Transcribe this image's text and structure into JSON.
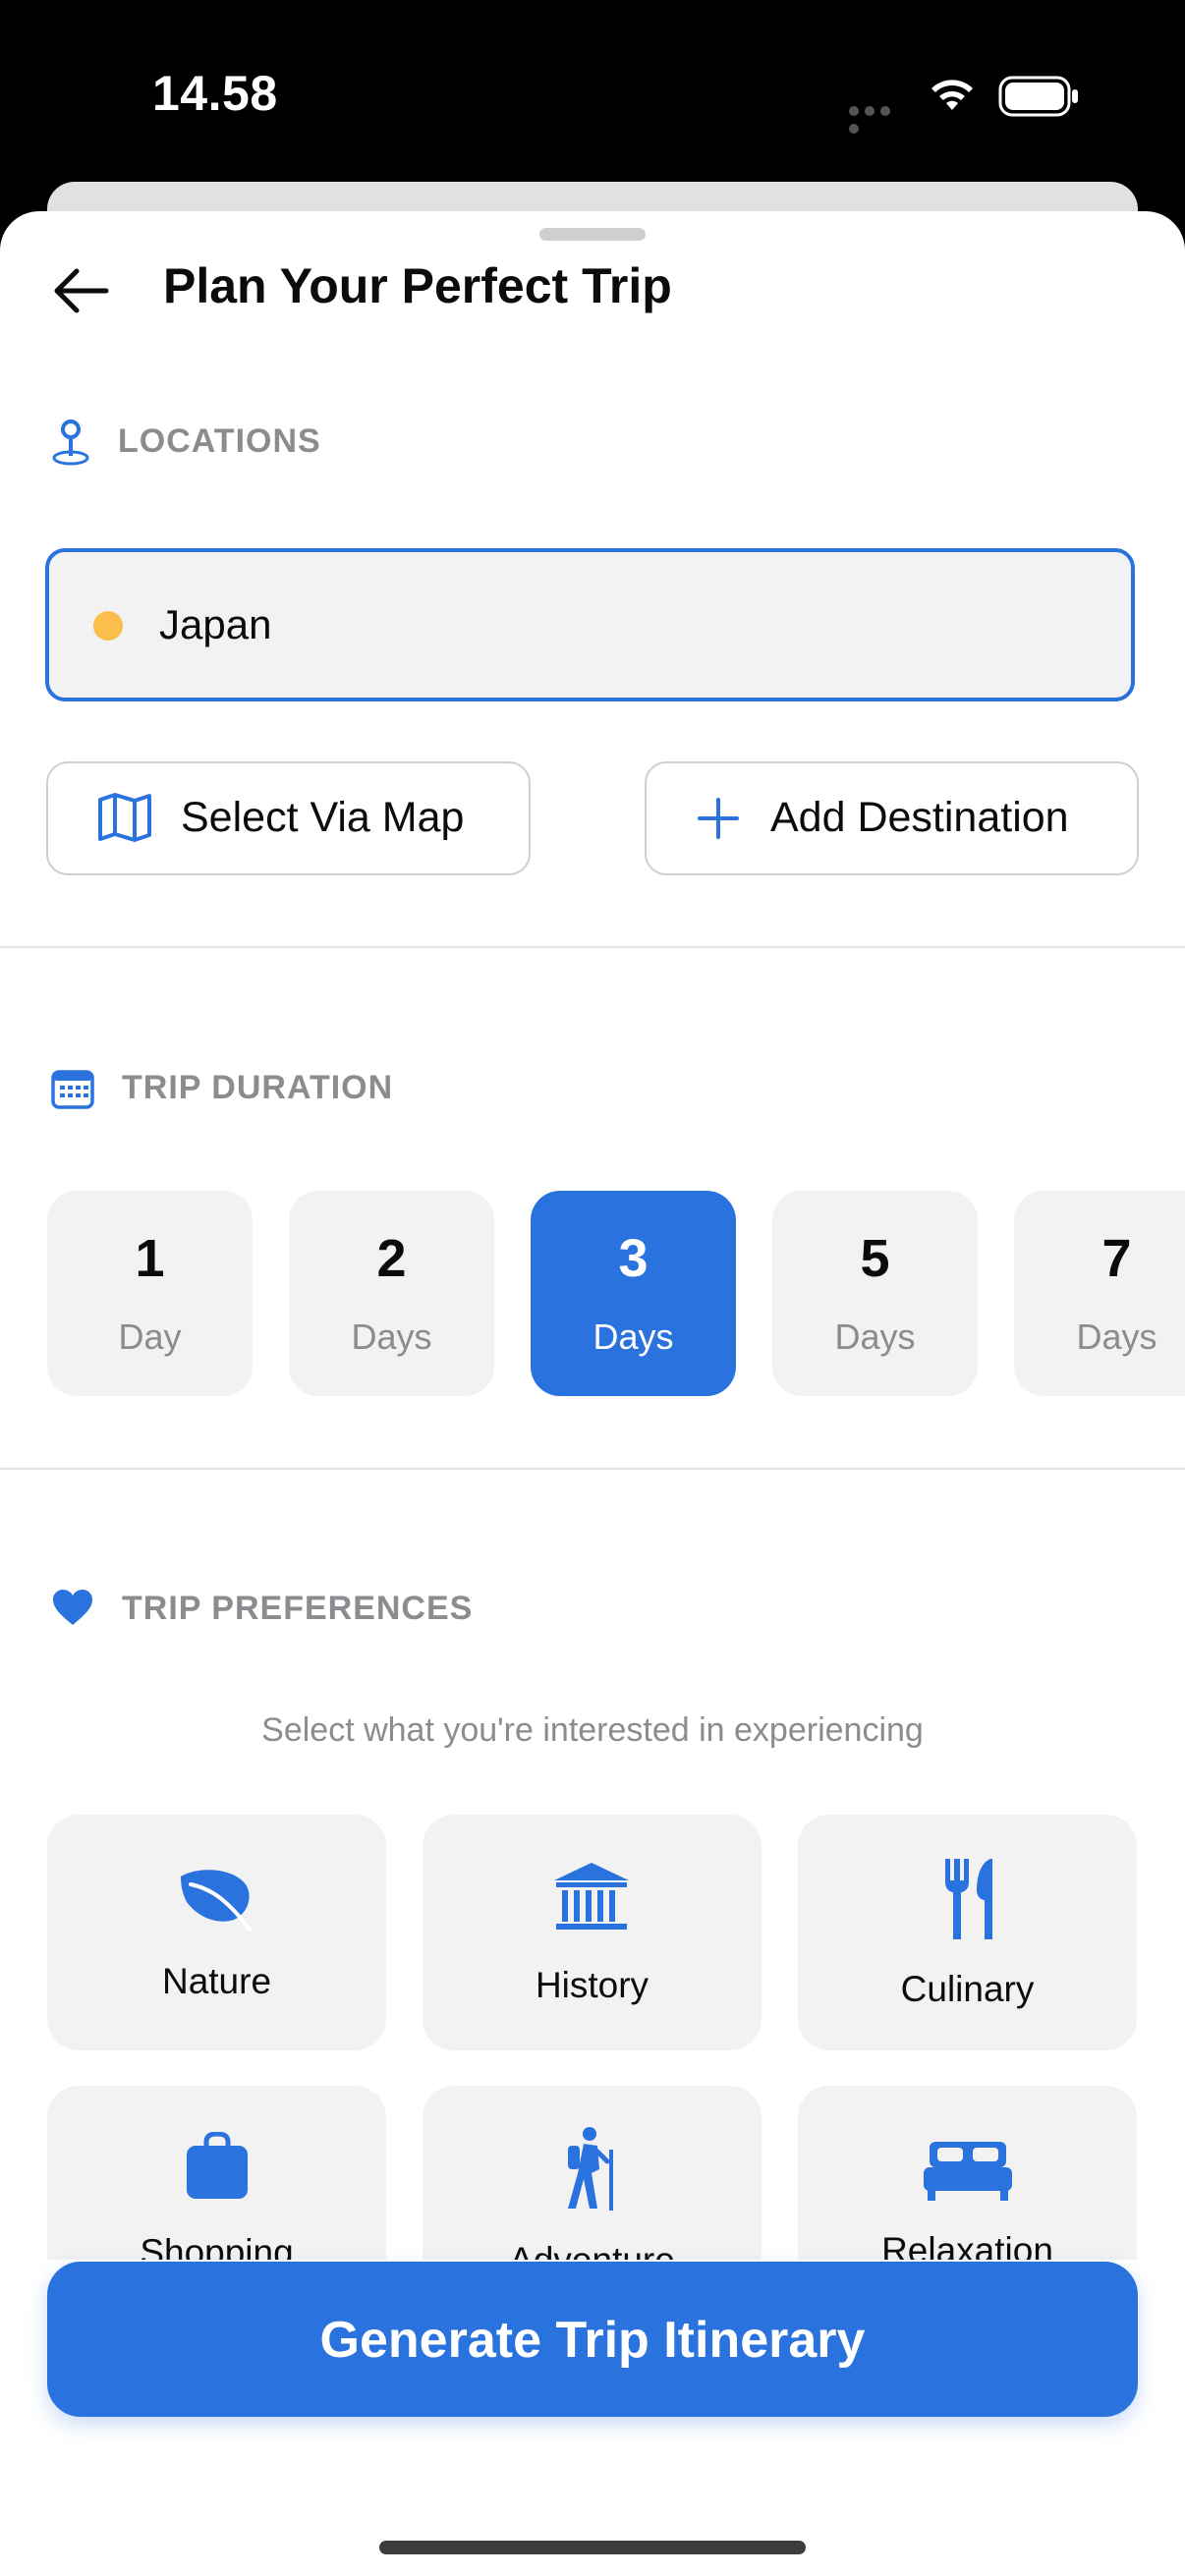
{
  "status_bar": {
    "time": "14.58"
  },
  "header": {
    "title": "Plan Your Perfect Trip"
  },
  "locations": {
    "label": "LOCATIONS",
    "destination_value": "Japan",
    "select_via_map": "Select Via Map",
    "add_destination": "Add Destination"
  },
  "duration": {
    "label": "TRIP DURATION",
    "options": [
      {
        "num": "1",
        "unit": "Day"
      },
      {
        "num": "2",
        "unit": "Days"
      },
      {
        "num": "3",
        "unit": "Days"
      },
      {
        "num": "5",
        "unit": "Days"
      },
      {
        "num": "7",
        "unit": "Days"
      }
    ],
    "selected_index": 2
  },
  "preferences": {
    "label": "TRIP PREFERENCES",
    "subtitle": "Select what you're interested in experiencing",
    "items": [
      {
        "label": "Nature",
        "icon": "leaf-icon"
      },
      {
        "label": "History",
        "icon": "museum-icon"
      },
      {
        "label": "Culinary",
        "icon": "fork-knife-icon"
      },
      {
        "label": "Shopping",
        "icon": "shopping-bag-icon"
      },
      {
        "label": "Adventure",
        "icon": "hiker-icon"
      },
      {
        "label": "Relaxation",
        "icon": "bed-icon"
      }
    ]
  },
  "footer": {
    "generate_label": "Generate Trip Itinerary"
  },
  "colors": {
    "accent": "#2A72DE",
    "dot": "#FBBD4B",
    "muted": "#8B8B90",
    "card": "#F2F2F2"
  }
}
